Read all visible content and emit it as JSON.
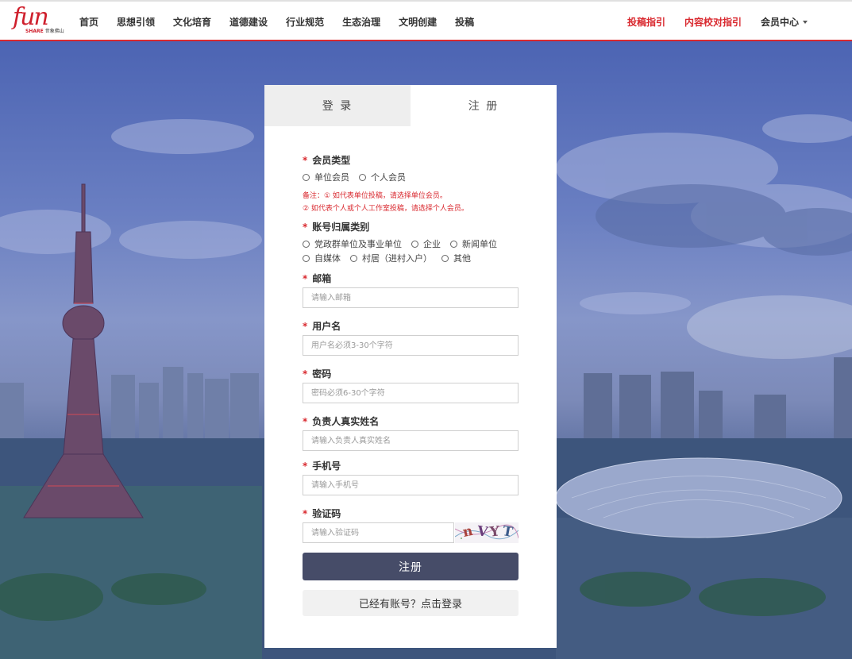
{
  "header": {
    "logo_text": "fun",
    "logo_share": "SHARE",
    "logo_sub": "世象佛山",
    "nav": [
      "首页",
      "思想引领",
      "文化培育",
      "道德建设",
      "行业规范",
      "生态治理",
      "文明创建",
      "投稿"
    ],
    "right_links": [
      "投稿指引",
      "内容校对指引"
    ],
    "member_center": "会员中心"
  },
  "tabs": {
    "login": "登 录",
    "register": "注 册"
  },
  "form": {
    "required_mark": "*",
    "member_type": {
      "label": "会员类型",
      "options": [
        "单位会员",
        "个人会员"
      ]
    },
    "notes": [
      "备注：① 如代表单位投稿，请选择单位会员。",
      "② 如代表个人或个人工作室投稿，请选择个人会员。"
    ],
    "account_category": {
      "label": "账号归属类别",
      "options_row1": [
        "党政群单位及事业单位",
        "企业",
        "新闻单位"
      ],
      "options_row2": [
        "自媒体",
        "村居（进村入户）",
        "其他"
      ]
    },
    "email": {
      "label": "邮箱",
      "placeholder": "请输入邮箱"
    },
    "username": {
      "label": "用户名",
      "placeholder": "用户名必须3-30个字符"
    },
    "password": {
      "label": "密码",
      "placeholder": "密码必须6-30个字符"
    },
    "real_name": {
      "label": "负责人真实姓名",
      "placeholder": "请输入负责人真实姓名"
    },
    "phone": {
      "label": "手机号",
      "placeholder": "请输入手机号"
    },
    "captcha": {
      "label": "验证码",
      "placeholder": "请输入验证码",
      "image_text": "nVYT"
    },
    "submit_label": "注册",
    "login_link": "已经有账号？点击登录"
  },
  "colors": {
    "brand_red": "#d9292f",
    "button_dark": "#464c68"
  },
  "icons": {
    "dropdown": "caret-down-icon",
    "radio": "radio-empty-icon"
  }
}
